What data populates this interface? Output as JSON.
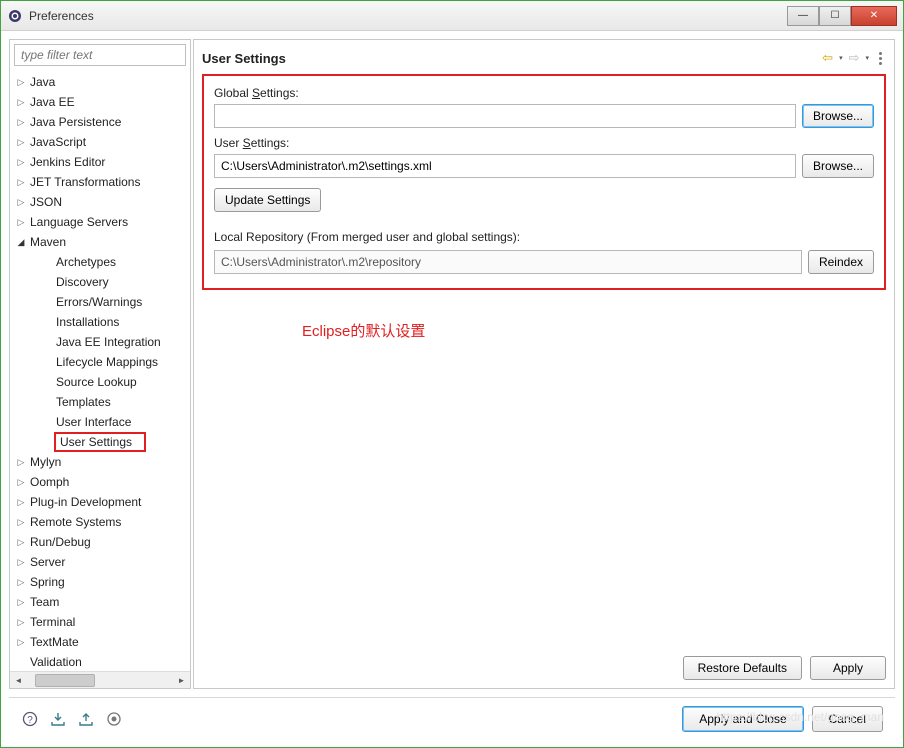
{
  "window": {
    "title": "Preferences"
  },
  "filter": {
    "placeholder": "type filter text"
  },
  "tree": {
    "items": [
      {
        "label": "Java",
        "level": 0,
        "arrow": "▷"
      },
      {
        "label": "Java EE",
        "level": 0,
        "arrow": "▷"
      },
      {
        "label": "Java Persistence",
        "level": 0,
        "arrow": "▷"
      },
      {
        "label": "JavaScript",
        "level": 0,
        "arrow": "▷"
      },
      {
        "label": "Jenkins Editor",
        "level": 0,
        "arrow": "▷"
      },
      {
        "label": "JET Transformations",
        "level": 0,
        "arrow": "▷"
      },
      {
        "label": "JSON",
        "level": 0,
        "arrow": "▷"
      },
      {
        "label": "Language Servers",
        "level": 0,
        "arrow": "▷"
      },
      {
        "label": "Maven",
        "level": 0,
        "arrow": "◢",
        "expanded": true
      },
      {
        "label": "Archetypes",
        "level": 1,
        "arrow": ""
      },
      {
        "label": "Discovery",
        "level": 1,
        "arrow": ""
      },
      {
        "label": "Errors/Warnings",
        "level": 1,
        "arrow": ""
      },
      {
        "label": "Installations",
        "level": 1,
        "arrow": ""
      },
      {
        "label": "Java EE Integration",
        "level": 1,
        "arrow": ""
      },
      {
        "label": "Lifecycle Mappings",
        "level": 1,
        "arrow": ""
      },
      {
        "label": "Source Lookup",
        "level": 1,
        "arrow": ""
      },
      {
        "label": "Templates",
        "level": 1,
        "arrow": ""
      },
      {
        "label": "User Interface",
        "level": 1,
        "arrow": ""
      },
      {
        "label": "User Settings",
        "level": 1,
        "arrow": "",
        "selected": true
      },
      {
        "label": "Mylyn",
        "level": 0,
        "arrow": "▷"
      },
      {
        "label": "Oomph",
        "level": 0,
        "arrow": "▷"
      },
      {
        "label": "Plug-in Development",
        "level": 0,
        "arrow": "▷"
      },
      {
        "label": "Remote Systems",
        "level": 0,
        "arrow": "▷"
      },
      {
        "label": "Run/Debug",
        "level": 0,
        "arrow": "▷"
      },
      {
        "label": "Server",
        "level": 0,
        "arrow": "▷"
      },
      {
        "label": "Spring",
        "level": 0,
        "arrow": "▷"
      },
      {
        "label": "Team",
        "level": 0,
        "arrow": "▷"
      },
      {
        "label": "Terminal",
        "level": 0,
        "arrow": "▷"
      },
      {
        "label": "TextMate",
        "level": 0,
        "arrow": "▷"
      },
      {
        "label": "Validation",
        "level": 0,
        "arrow": ""
      }
    ]
  },
  "page": {
    "title": "User Settings",
    "global_label_pre": "Global ",
    "global_label_u": "S",
    "global_label_post": "ettings:",
    "global_value": "",
    "user_label_pre": "User ",
    "user_label_u": "S",
    "user_label_post": "ettings:",
    "user_value": "C:\\Users\\Administrator\\.m2\\settings.xml",
    "browse1": "Browse...",
    "browse2": "Browse...",
    "update": "Update Settings",
    "local_repo_label": "Local Repository (From merged user and global settings):",
    "local_repo_value": "C:\\Users\\Administrator\\.m2\\repository",
    "reindex": "Reindex",
    "annotation": "Eclipse的默认设置",
    "restore": "Restore Defaults",
    "apply": "Apply"
  },
  "footer": {
    "apply_close": "Apply and Close",
    "cancel": "Cancel"
  },
  "watermark": "https://blog.csdn.net/goog_man"
}
